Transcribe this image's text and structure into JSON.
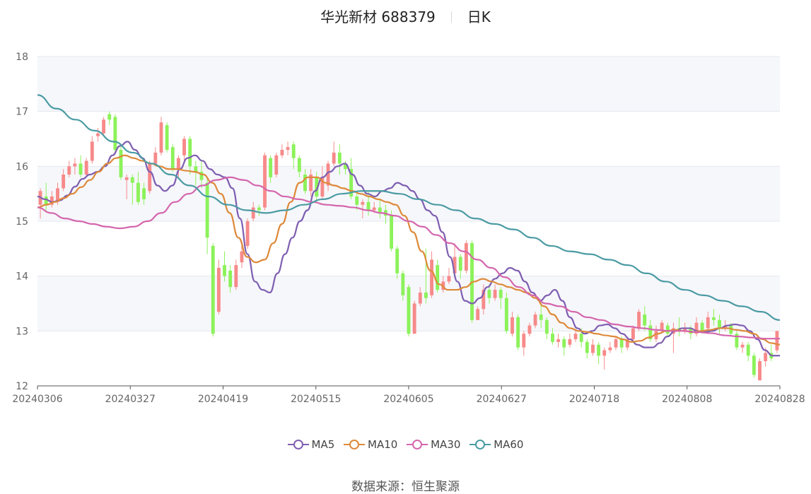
{
  "header": {
    "stock": "华光新材 688379",
    "period": "日K"
  },
  "source": {
    "label": "数据来源：",
    "name": "恒生聚源"
  },
  "colors": {
    "up": "#f78a8a",
    "down": "#8cf25a",
    "ma5": "#7f5fb1",
    "ma10": "#dd8a3a",
    "ma30": "#d466ad",
    "ma60": "#4b9ba3",
    "grid": "#e3e7ef",
    "band": "#f6f7fb"
  },
  "chart_data": {
    "type": "candlestick",
    "ylim": [
      12,
      18
    ],
    "yticks": [
      12,
      13,
      14,
      15,
      16,
      17,
      18
    ],
    "xticks": [
      "20240306",
      "20240327",
      "20240419",
      "20240515",
      "20240605",
      "20240627",
      "20240718",
      "20240808",
      "20240828"
    ],
    "grid": true,
    "legend_position": "bottom",
    "series_names": [
      "MA5",
      "MA10",
      "MA30",
      "MA60"
    ],
    "candles": [
      [
        15.3,
        15.55,
        15.05,
        15.6
      ],
      [
        15.45,
        15.3,
        15.2,
        15.7
      ],
      [
        15.3,
        15.45,
        15.25,
        15.55
      ],
      [
        15.35,
        15.6,
        15.3,
        15.7
      ],
      [
        15.6,
        15.85,
        15.55,
        15.95
      ],
      [
        15.85,
        16.0,
        15.8,
        16.1
      ],
      [
        16.0,
        16.05,
        15.85,
        16.15
      ],
      [
        16.05,
        15.85,
        15.8,
        16.2
      ],
      [
        15.85,
        16.1,
        15.8,
        16.15
      ],
      [
        16.1,
        16.45,
        16.05,
        16.55
      ],
      [
        16.55,
        16.6,
        16.45,
        16.7
      ],
      [
        16.6,
        16.85,
        16.55,
        16.9
      ],
      [
        16.95,
        16.85,
        16.75,
        17.0
      ],
      [
        16.9,
        16.3,
        16.25,
        16.95
      ],
      [
        16.3,
        15.8,
        15.75,
        16.35
      ],
      [
        15.75,
        15.8,
        15.4,
        15.85
      ],
      [
        15.8,
        15.7,
        15.3,
        15.85
      ],
      [
        15.7,
        15.35,
        15.3,
        15.9
      ],
      [
        15.6,
        15.4,
        15.3,
        15.7
      ],
      [
        15.55,
        16.05,
        15.5,
        16.1
      ],
      [
        16.05,
        16.25,
        16.0,
        16.35
      ],
      [
        16.25,
        16.8,
        16.2,
        16.9
      ],
      [
        16.75,
        16.3,
        16.25,
        16.8
      ],
      [
        16.35,
        15.95,
        15.9,
        16.4
      ],
      [
        15.95,
        16.15,
        15.8,
        16.2
      ],
      [
        16.2,
        16.5,
        16.1,
        16.55
      ],
      [
        16.5,
        16.0,
        15.85,
        16.55
      ],
      [
        16.0,
        15.9,
        15.65,
        16.1
      ],
      [
        15.9,
        15.75,
        15.6,
        16.1
      ],
      [
        15.7,
        14.7,
        14.4,
        15.8
      ],
      [
        14.55,
        12.95,
        12.9,
        14.6
      ],
      [
        13.35,
        14.15,
        13.3,
        14.3
      ],
      [
        14.2,
        14.0,
        13.9,
        14.45
      ],
      [
        14.1,
        13.8,
        13.7,
        14.2
      ],
      [
        13.8,
        14.2,
        13.75,
        14.3
      ],
      [
        14.25,
        14.45,
        14.15,
        14.6
      ],
      [
        14.55,
        15.0,
        14.5,
        15.05
      ],
      [
        15.05,
        15.25,
        15.0,
        15.35
      ],
      [
        15.25,
        15.2,
        15.1,
        15.3
      ],
      [
        15.25,
        16.2,
        15.2,
        16.25
      ],
      [
        16.15,
        15.8,
        15.7,
        16.2
      ],
      [
        15.85,
        16.2,
        15.8,
        16.25
      ],
      [
        16.2,
        16.3,
        16.15,
        16.4
      ],
      [
        16.3,
        16.35,
        16.2,
        16.45
      ],
      [
        16.4,
        16.15,
        15.95,
        16.45
      ],
      [
        16.15,
        15.9,
        15.8,
        16.2
      ],
      [
        15.85,
        15.55,
        15.5,
        15.95
      ],
      [
        15.55,
        15.85,
        15.45,
        15.95
      ],
      [
        15.8,
        15.45,
        15.35,
        15.9
      ],
      [
        15.45,
        15.8,
        15.4,
        16.0
      ],
      [
        15.65,
        16.05,
        15.55,
        16.1
      ],
      [
        16.05,
        16.25,
        16.0,
        16.45
      ],
      [
        16.25,
        16.05,
        15.85,
        16.4
      ],
      [
        16.05,
        15.95,
        15.85,
        16.1
      ],
      [
        15.95,
        15.45,
        15.4,
        16.15
      ],
      [
        15.45,
        15.3,
        15.2,
        15.55
      ],
      [
        15.3,
        15.35,
        15.05,
        15.4
      ],
      [
        15.35,
        15.2,
        15.1,
        15.55
      ],
      [
        15.2,
        15.25,
        15.15,
        15.35
      ],
      [
        15.25,
        15.15,
        15.05,
        15.4
      ],
      [
        15.2,
        15.1,
        14.95,
        15.3
      ],
      [
        15.1,
        14.5,
        14.45,
        15.2
      ],
      [
        14.5,
        14.05,
        13.95,
        14.55
      ],
      [
        14.05,
        13.65,
        13.55,
        14.1
      ],
      [
        13.8,
        12.95,
        12.9,
        13.85
      ],
      [
        12.95,
        13.5,
        12.95,
        13.55
      ],
      [
        13.5,
        13.7,
        13.45,
        13.8
      ],
      [
        13.7,
        13.6,
        13.5,
        14.5
      ],
      [
        13.65,
        14.3,
        13.6,
        14.45
      ],
      [
        14.2,
        13.75,
        13.7,
        14.3
      ],
      [
        13.75,
        13.9,
        13.7,
        14.0
      ],
      [
        13.9,
        14.0,
        13.85,
        14.15
      ],
      [
        14.05,
        14.35,
        14.0,
        14.6
      ],
      [
        14.35,
        14.1,
        13.95,
        14.4
      ],
      [
        14.1,
        14.6,
        14.05,
        14.65
      ],
      [
        14.6,
        13.2,
        13.15,
        14.65
      ],
      [
        13.2,
        13.4,
        13.2,
        13.45
      ],
      [
        13.4,
        13.75,
        13.3,
        13.85
      ],
      [
        13.75,
        13.6,
        13.5,
        13.85
      ],
      [
        13.6,
        13.75,
        13.55,
        13.85
      ],
      [
        13.75,
        13.6,
        13.4,
        13.8
      ],
      [
        13.6,
        13.0,
        12.95,
        13.7
      ],
      [
        12.95,
        13.25,
        12.9,
        13.35
      ],
      [
        13.25,
        12.7,
        12.65,
        13.3
      ],
      [
        12.7,
        12.95,
        12.55,
        13.0
      ],
      [
        12.95,
        13.1,
        12.9,
        13.15
      ],
      [
        13.1,
        13.3,
        13.05,
        13.35
      ],
      [
        13.3,
        13.2,
        13.05,
        13.55
      ],
      [
        13.2,
        12.95,
        12.85,
        13.25
      ],
      [
        12.95,
        12.8,
        12.75,
        13.05
      ],
      [
        12.8,
        12.85,
        12.7,
        12.95
      ],
      [
        12.85,
        12.7,
        12.55,
        12.9
      ],
      [
        12.75,
        12.85,
        12.7,
        12.95
      ],
      [
        12.85,
        12.95,
        12.8,
        13.0
      ],
      [
        12.95,
        12.8,
        12.7,
        13.05
      ],
      [
        12.8,
        12.6,
        12.5,
        12.85
      ],
      [
        12.6,
        12.75,
        12.55,
        12.85
      ],
      [
        12.75,
        12.55,
        12.4,
        12.8
      ],
      [
        12.55,
        12.65,
        12.3,
        12.7
      ],
      [
        12.65,
        12.7,
        12.6,
        12.8
      ],
      [
        12.7,
        12.85,
        12.65,
        12.9
      ],
      [
        12.85,
        12.7,
        12.6,
        12.9
      ],
      [
        12.7,
        12.85,
        12.65,
        12.9
      ],
      [
        12.85,
        13.05,
        12.8,
        13.1
      ],
      [
        13.05,
        13.35,
        13.0,
        13.4
      ],
      [
        13.3,
        13.1,
        13.0,
        13.45
      ],
      [
        13.1,
        12.85,
        12.8,
        13.2
      ],
      [
        12.85,
        13.0,
        12.8,
        13.1
      ],
      [
        13.0,
        13.15,
        12.95,
        13.2
      ],
      [
        13.1,
        12.95,
        12.9,
        13.15
      ],
      [
        12.95,
        13.05,
        12.6,
        13.15
      ],
      [
        13.05,
        13.0,
        12.9,
        13.25
      ],
      [
        13.0,
        13.05,
        12.95,
        13.15
      ],
      [
        13.05,
        12.95,
        12.85,
        13.1
      ],
      [
        12.95,
        13.15,
        12.9,
        13.25
      ],
      [
        13.15,
        13.0,
        12.95,
        13.2
      ],
      [
        13.05,
        13.25,
        13.0,
        13.35
      ],
      [
        13.25,
        13.2,
        13.1,
        13.4
      ],
      [
        13.2,
        13.05,
        12.95,
        13.3
      ],
      [
        13.05,
        13.1,
        13.0,
        13.2
      ],
      [
        13.1,
        12.95,
        12.9,
        13.15
      ],
      [
        12.95,
        12.7,
        12.65,
        13.0
      ],
      [
        12.7,
        12.75,
        12.6,
        12.8
      ],
      [
        12.75,
        12.55,
        12.45,
        12.8
      ],
      [
        12.55,
        12.2,
        12.15,
        12.6
      ],
      [
        12.1,
        12.45,
        12.1,
        12.5
      ],
      [
        12.45,
        12.6,
        12.35,
        12.7
      ],
      [
        12.6,
        12.5,
        12.45,
        12.75
      ],
      [
        12.65,
        13.0,
        12.6,
        13.0
      ]
    ],
    "ma": {
      "MA5": [
        15.45,
        15.4,
        15.35,
        15.38,
        15.47,
        15.63,
        15.77,
        15.85,
        15.9,
        16.0,
        16.2,
        16.37,
        16.45,
        16.3,
        16.15,
        15.9,
        15.65,
        15.55,
        15.65,
        15.95,
        16.15,
        16.2,
        16.1,
        15.95,
        15.85,
        15.8,
        15.6,
        15.05,
        14.4,
        13.9,
        13.75,
        13.7,
        14.05,
        14.4,
        14.7,
        15.0,
        15.2,
        15.55,
        15.8,
        15.9,
        16.0,
        16.05,
        15.85,
        15.65,
        15.5,
        15.45,
        15.55,
        15.6,
        15.7,
        15.65,
        15.55,
        15.4,
        15.2,
        15.1,
        14.8,
        14.35,
        13.9,
        13.55,
        13.5,
        13.6,
        13.8,
        13.95,
        14.05,
        14.15,
        14.1,
        13.9,
        13.7,
        13.55,
        13.65,
        13.75,
        13.55,
        13.25,
        13.05,
        12.95,
        13.0,
        13.1,
        13.12,
        13.05,
        12.95,
        12.85,
        12.75,
        12.7,
        12.7,
        12.78,
        12.9,
        13.0,
        13.05,
        13.05,
        13.0,
        12.98,
        13.0,
        13.05,
        13.1,
        13.12,
        13.1,
        13.0,
        12.85,
        12.65,
        12.55,
        12.55
      ],
      "MA10": [
        15.25,
        15.3,
        15.35,
        15.42,
        15.5,
        15.62,
        15.75,
        15.9,
        16.05,
        16.15,
        16.2,
        16.15,
        16.1,
        16.05,
        16.0,
        15.95,
        15.95,
        15.92,
        15.9,
        15.85,
        15.7,
        15.5,
        15.15,
        14.7,
        14.35,
        14.25,
        14.3,
        14.6,
        14.95,
        15.35,
        15.7,
        15.8,
        15.8,
        15.7,
        15.65,
        15.6,
        15.55,
        15.5,
        15.45,
        15.4,
        15.35,
        15.3,
        15.1,
        14.8,
        14.45,
        14.1,
        13.85,
        13.75,
        13.75,
        13.8,
        13.9,
        13.95,
        13.9,
        13.85,
        13.8,
        13.75,
        13.7,
        13.6,
        13.45,
        13.3,
        13.15,
        13.05,
        13.0,
        12.98,
        12.95,
        12.92,
        12.9,
        12.85,
        12.8,
        12.82,
        12.88,
        12.95,
        13.0,
        13.02,
        13.0,
        12.98,
        13.0,
        13.02,
        13.05,
        13.05,
        13.02,
        13.0,
        12.95,
        12.85,
        12.78,
        12.75
      ],
      "MA30": [
        15.25,
        15.15,
        15.05,
        15.0,
        14.95,
        14.9,
        14.87,
        14.9,
        15.0,
        15.15,
        15.35,
        15.5,
        15.65,
        15.75,
        15.8,
        15.75,
        15.65,
        15.55,
        15.45,
        15.4,
        15.35,
        15.3,
        15.28,
        15.25,
        15.2,
        15.15,
        15.1,
        15.0,
        14.9,
        14.75,
        14.6,
        14.45,
        14.3,
        14.15,
        13.98,
        13.8,
        13.65,
        13.5,
        13.45,
        13.35,
        13.25,
        13.2,
        13.12,
        13.08,
        13.05,
        13.02,
        13.0,
        13.0,
        12.98,
        12.96,
        12.92,
        12.9,
        12.88,
        12.86,
        12.86
      ],
      "MA60": [
        17.3,
        17.05,
        16.85,
        16.65,
        16.45,
        16.25,
        16.05,
        15.85,
        15.65,
        15.45,
        15.3,
        15.2,
        15.15,
        15.2,
        15.3,
        15.4,
        15.5,
        15.55,
        15.55,
        15.5,
        15.4,
        15.3,
        15.2,
        15.05,
        14.95,
        14.85,
        14.7,
        14.55,
        14.45,
        14.4,
        14.3,
        14.2,
        14.05,
        13.9,
        13.75,
        13.65,
        13.55,
        13.45,
        13.35,
        13.2
      ]
    }
  }
}
